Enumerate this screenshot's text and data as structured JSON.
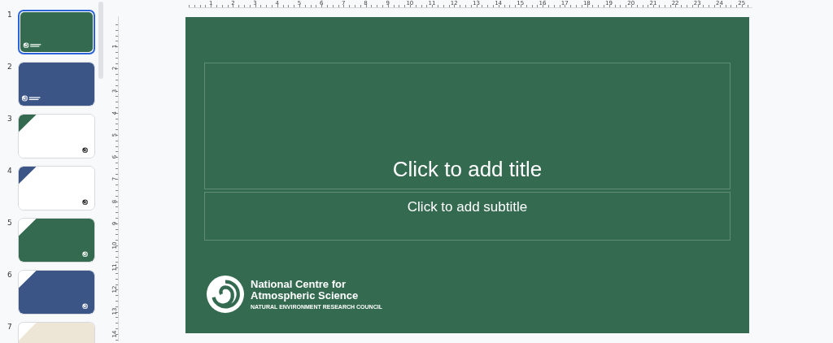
{
  "slides": [
    {
      "number": "1",
      "kind": "title",
      "color": "#346b50",
      "selected": true
    },
    {
      "number": "2",
      "kind": "title",
      "color": "#3b5587",
      "selected": false
    },
    {
      "number": "3",
      "kind": "corner",
      "color": "#346b50",
      "selected": false
    },
    {
      "number": "4",
      "kind": "corner",
      "color": "#3b5587",
      "selected": false
    },
    {
      "number": "5",
      "kind": "section",
      "color": "#346b50",
      "selected": false
    },
    {
      "number": "6",
      "kind": "section",
      "color": "#3b5587",
      "selected": false
    },
    {
      "number": "7",
      "kind": "section",
      "color": "#ede6d6",
      "selected": false,
      "cut_off": true
    }
  ],
  "ruler_horizontal": [
    "1",
    "2",
    "3",
    "4",
    "5",
    "6",
    "7",
    "8",
    "9",
    "10",
    "11",
    "12",
    "13",
    "14",
    "15",
    "16",
    "17",
    "18",
    "19",
    "20",
    "21",
    "22",
    "23",
    "24",
    "25"
  ],
  "ruler_vertical": [
    "1",
    "2",
    "3",
    "4",
    "5",
    "6",
    "7",
    "8",
    "9",
    "10",
    "11",
    "12",
    "13",
    "14"
  ],
  "slide": {
    "color": "#346b50",
    "title_placeholder": "Click to add title",
    "subtitle_placeholder": "Click to add subtitle",
    "logo": {
      "name_line_1": "National Centre for",
      "name_line_2": "Atmospheric Science",
      "tagline": "NATURAL ENVIRONMENT RESEARCH COUNCIL"
    }
  }
}
